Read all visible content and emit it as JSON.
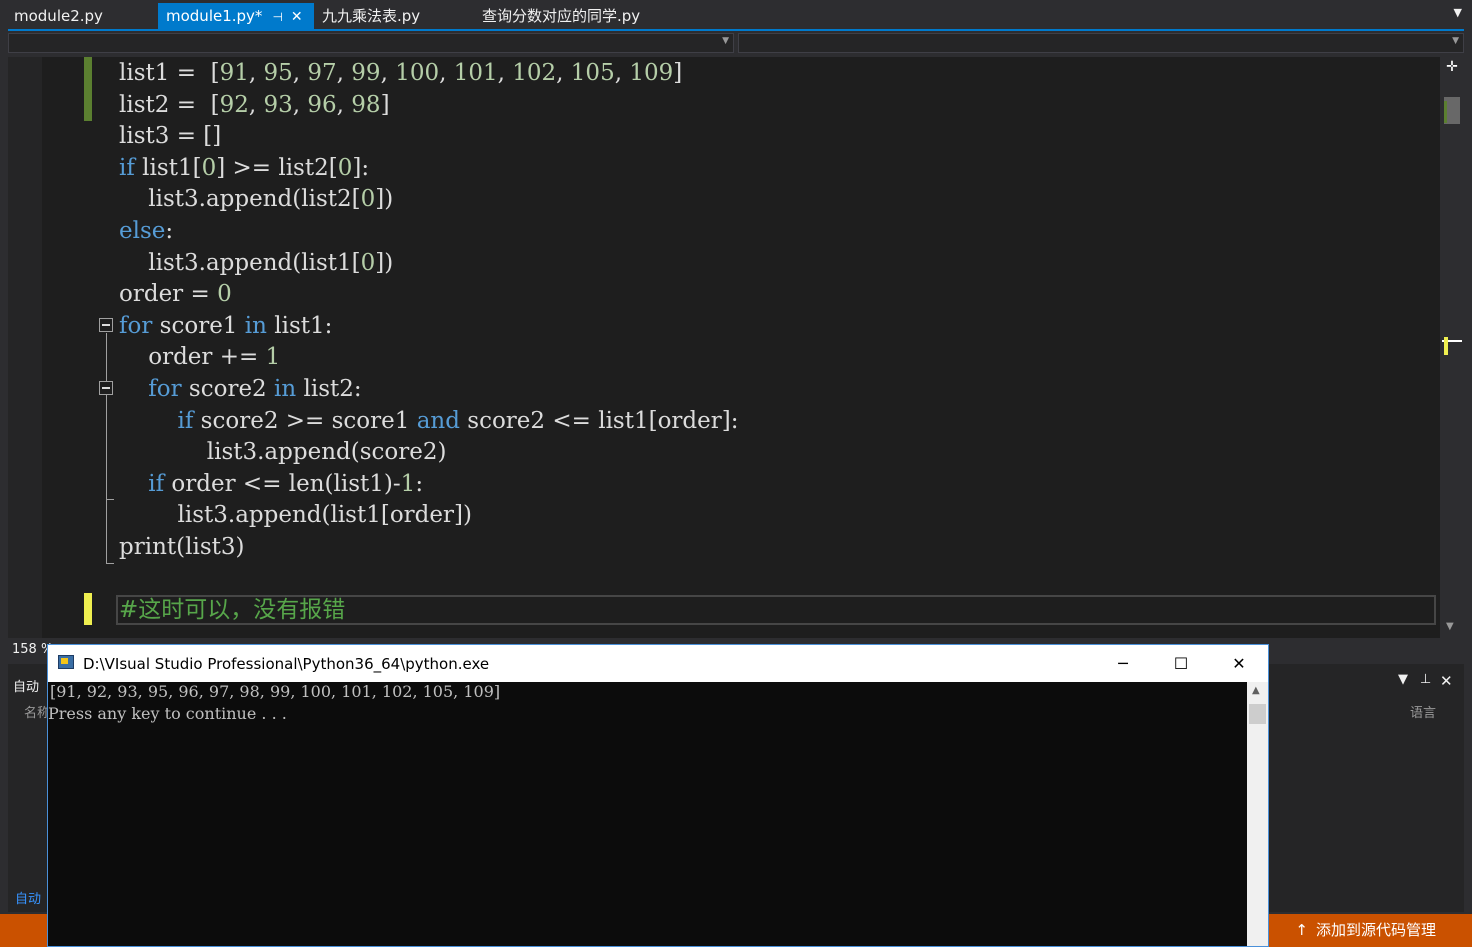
{
  "tabs": [
    {
      "label": "module2.py"
    },
    {
      "label": "module1.py*",
      "active": true
    },
    {
      "label": "九九乘法表.py"
    },
    {
      "label": "查询分数对应的同学.py"
    }
  ],
  "code_lines": [
    [
      {
        "t": "list1 =  ["
      },
      {
        "t": "91",
        "c": "num"
      },
      {
        "t": ", "
      },
      {
        "t": "95",
        "c": "num"
      },
      {
        "t": ", "
      },
      {
        "t": "97",
        "c": "num"
      },
      {
        "t": ", "
      },
      {
        "t": "99",
        "c": "num"
      },
      {
        "t": ", "
      },
      {
        "t": "100",
        "c": "num"
      },
      {
        "t": ", "
      },
      {
        "t": "101",
        "c": "num"
      },
      {
        "t": ", "
      },
      {
        "t": "102",
        "c": "num"
      },
      {
        "t": ", "
      },
      {
        "t": "105",
        "c": "num"
      },
      {
        "t": ", "
      },
      {
        "t": "109",
        "c": "num"
      },
      {
        "t": "]"
      }
    ],
    [
      {
        "t": "list2 =  ["
      },
      {
        "t": "92",
        "c": "num"
      },
      {
        "t": ", "
      },
      {
        "t": "93",
        "c": "num"
      },
      {
        "t": ", "
      },
      {
        "t": "96",
        "c": "num"
      },
      {
        "t": ", "
      },
      {
        "t": "98",
        "c": "num"
      },
      {
        "t": "]"
      }
    ],
    [
      {
        "t": "list3 = []"
      }
    ],
    [
      {
        "t": "if",
        "c": "kw"
      },
      {
        "t": " list1["
      },
      {
        "t": "0",
        "c": "num"
      },
      {
        "t": "] >= list2["
      },
      {
        "t": "0",
        "c": "num"
      },
      {
        "t": "]:"
      }
    ],
    [
      {
        "t": "    list3.append(list2["
      },
      {
        "t": "0",
        "c": "num"
      },
      {
        "t": "])"
      }
    ],
    [
      {
        "t": "else",
        "c": "kw"
      },
      {
        "t": ":"
      }
    ],
    [
      {
        "t": "    list3.append(list1["
      },
      {
        "t": "0",
        "c": "num"
      },
      {
        "t": "])"
      }
    ],
    [
      {
        "t": "order = "
      },
      {
        "t": "0",
        "c": "num"
      }
    ],
    [
      {
        "t": "for",
        "c": "kw"
      },
      {
        "t": " score1 "
      },
      {
        "t": "in",
        "c": "kw"
      },
      {
        "t": " list1:"
      }
    ],
    [
      {
        "t": "    order += "
      },
      {
        "t": "1",
        "c": "num"
      }
    ],
    [
      {
        "t": "    "
      },
      {
        "t": "for",
        "c": "kw"
      },
      {
        "t": " score2 "
      },
      {
        "t": "in",
        "c": "kw"
      },
      {
        "t": " list2:"
      }
    ],
    [
      {
        "t": "        "
      },
      {
        "t": "if",
        "c": "kw"
      },
      {
        "t": " score2 >= score1 "
      },
      {
        "t": "and",
        "c": "kw"
      },
      {
        "t": " score2 <= list1[order]:"
      }
    ],
    [
      {
        "t": "            list3.append(score2)"
      }
    ],
    [
      {
        "t": "    "
      },
      {
        "t": "if",
        "c": "kw"
      },
      {
        "t": " order <= len(list1)-"
      },
      {
        "t": "1",
        "c": "num"
      },
      {
        "t": ":"
      }
    ],
    [
      {
        "t": "        list3.append(list1[order])"
      }
    ],
    [
      {
        "t": "print(list3)"
      }
    ],
    [],
    [
      {
        "t": "#这时可以，没有报错",
        "c": "cmt"
      }
    ]
  ],
  "editor": {
    "zoom": "158 %"
  },
  "console": {
    "title": "D:\\VIsual Studio Professional\\Python36_64\\python.exe",
    "output": [
      "[91, 92, 93, 95, 96, 97, 98, 99, 100, 101, 102, 105, 109]",
      "Press any key to continue . . ."
    ]
  },
  "bottom_panel": {
    "title": "自动",
    "col_name": "名称",
    "col_lang": "语言",
    "footer": "自动"
  },
  "status": {
    "source_control": "添加到源代码管理"
  },
  "colors": {
    "accent": "#007acc",
    "status": "#ca5100",
    "keyword": "#569cd6",
    "number": "#b5cea8",
    "comment": "#57a64a"
  }
}
